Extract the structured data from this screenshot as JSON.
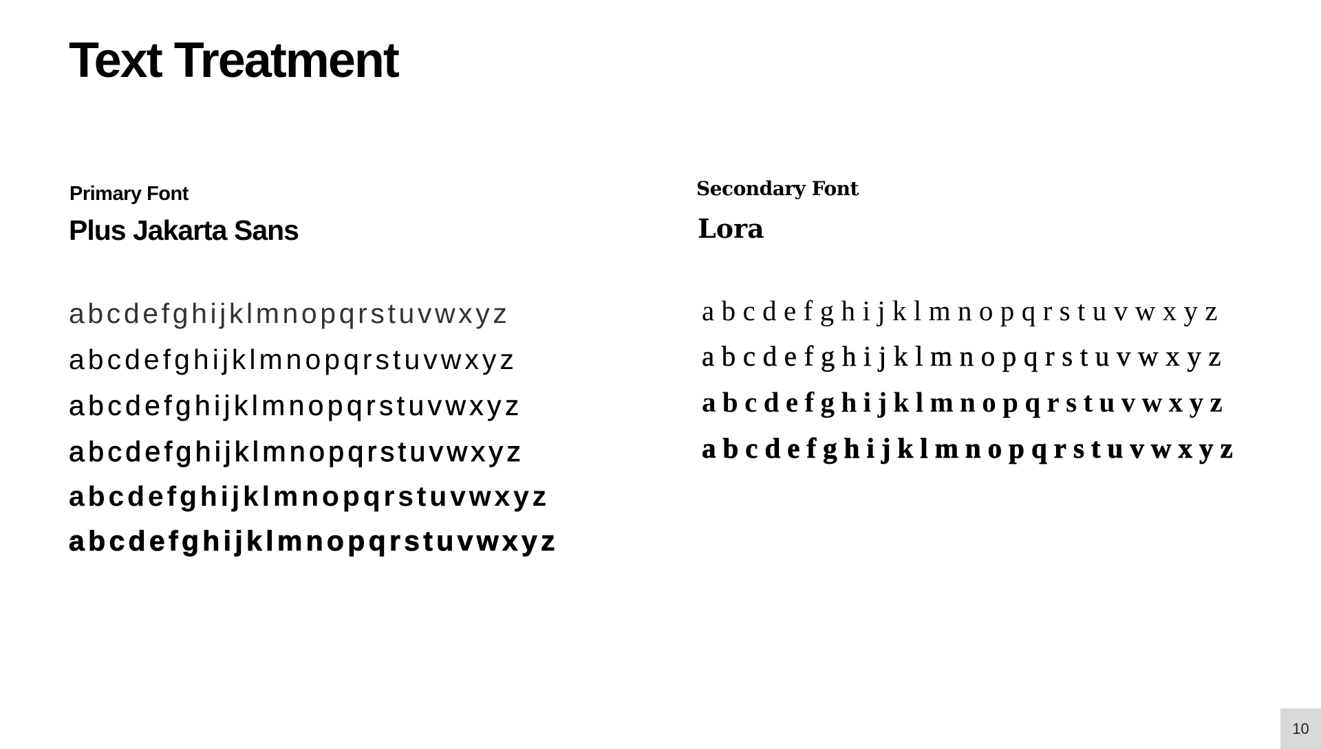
{
  "title": "Text Treatment",
  "primary": {
    "label": "Primary Font",
    "name": "Plus Jakarta Sans",
    "samples": [
      "abcdefghijklmnopqrstuvwxyz",
      "abcdefghijklmnopqrstuvwxyz",
      "abcdefghijklmnopqrstuvwxyz",
      "abcdefghijklmnopqrstuvwxyz",
      "abcdefghijklmnopqrstuvwxyz",
      "abcdefghijklmnopqrstuvwxyz"
    ]
  },
  "secondary": {
    "label": "Secondary Font",
    "name": "Lora",
    "samples": [
      "abcdefghijklmnopqrstuvwxyz",
      "abcdefghijklmnopqrstuvwxyz",
      "abcdefghijklmnopqrstuvwxyz",
      "abcdefghijklmnopqrstuvwxyz"
    ]
  },
  "page_number": "10"
}
